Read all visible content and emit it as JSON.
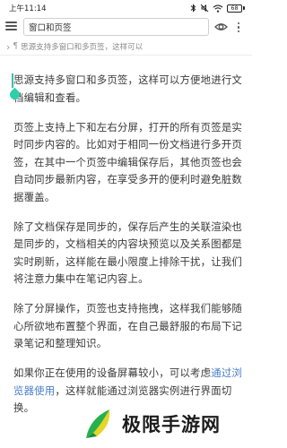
{
  "status_bar": {
    "time": "上午11:14",
    "battery_level": "68"
  },
  "toolbar": {
    "doc_title": "窗口和页签"
  },
  "breadcrumb": {
    "text": "思源支持多窗口和多页签，这样可以"
  },
  "editor": {
    "paragraphs": [
      "思源支持多窗口和多页签，这样可以方便地进行文档编辑和查看。",
      "页签上支持上下和左右分屏，打开的所有页签是实时同步内容的。比如对于相同一份文档进行多开页签，在其中一个页签中编辑保存后，其他页签也会自动同步最新内容，在享受多开的便利时避免脏数据覆盖。",
      "除了文档保存是同步的，保存后产生的关联渲染也是同步的，文档相关的内容块预览以及关系图都是实时刷新，这样能在最小限度上排除干扰，让我们将注意力集中在笔记内容上。",
      "除了分屏操作，页签也支持拖拽，这样我们能够随心所欲地布置整个界面，在自己最舒服的布局下记录笔记和整理知识。"
    ],
    "last_paragraph": {
      "before_link": "如果你正在使用的设备屏幕较小，可以考虑",
      "link": "通过浏览器使用",
      "after_link": "，这样就能通过浏览器实例进行界面切换。"
    }
  },
  "watermark": {
    "text": "极限手游网"
  },
  "colors": {
    "link": "#4a7ec7",
    "accent": "#2fd0a8",
    "text": "#3a3a3a"
  },
  "icons": {
    "status": [
      "bluetooth-icon",
      "mute-icon",
      "wifi-icon",
      "battery-icon"
    ],
    "toolbar": [
      "menu-icon",
      "eye-icon",
      "more-vertical-icon"
    ],
    "breadcrumb": [
      "chevron-right-icon",
      "paragraph-icon"
    ]
  }
}
